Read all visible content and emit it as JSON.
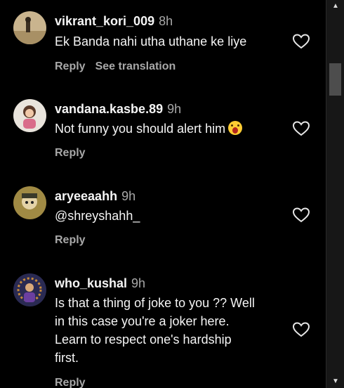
{
  "comments": [
    {
      "username": "vikrant_kori_009",
      "time": "8h",
      "text": "Ek Banda nahi utha uthane ke liye",
      "reply": "Reply",
      "translate": "See translation"
    },
    {
      "username": "vandana.kasbe.89",
      "time": "9h",
      "text": "Not funny you should alert him",
      "emoji": "astonished-face-emoji",
      "reply": "Reply"
    },
    {
      "username": "aryeeaahh",
      "time": "9h",
      "text": "@shreyshahh_",
      "reply": "Reply"
    },
    {
      "username": "who_kushal",
      "time": "9h",
      "text": "Is that a thing of joke to you ?? Well\nin this case you're a joker here.\nLearn to respect one's hardship\nfirst.",
      "reply": "Reply"
    }
  ],
  "icons": {
    "heart": "heart-outline-icon",
    "scroll_up": "scroll-up-arrow-icon",
    "scroll_down": "scroll-down-arrow-icon"
  },
  "colors": {
    "background": "#000000",
    "text": "#f5f5f5",
    "muted": "#a8a8a8"
  }
}
